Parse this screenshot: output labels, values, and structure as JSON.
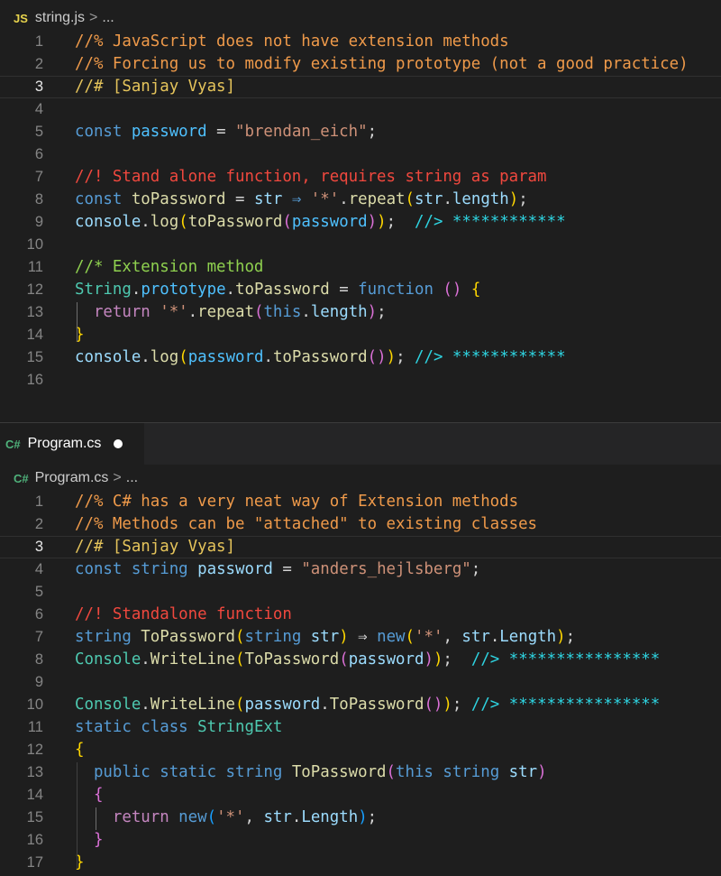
{
  "editor_top": {
    "breadcrumb": {
      "icon": "JS",
      "file": "string.js",
      "sep": ">",
      "more": "..."
    },
    "lines": [
      {
        "n": "1",
        "tokens": [
          [
            "//% JavaScript does not have extension methods",
            "#ef9a4a"
          ]
        ]
      },
      {
        "n": "2",
        "tokens": [
          [
            "//% Forcing us to modify existing prototype (not a good practice)",
            "#ef9a4a"
          ]
        ]
      },
      {
        "n": "3",
        "current": true,
        "tokens": [
          [
            "//# [Sanjay Vyas]",
            "#e5c45b"
          ]
        ]
      },
      {
        "n": "4",
        "tokens": []
      },
      {
        "n": "5",
        "tokens": [
          [
            "const ",
            "#569cd6"
          ],
          [
            "password",
            "#4fc1ff"
          ],
          [
            " = ",
            "#d4d4d4"
          ],
          [
            "\"brendan_eich\"",
            "#ce9178"
          ],
          [
            ";",
            "#d4d4d4"
          ]
        ]
      },
      {
        "n": "6",
        "tokens": []
      },
      {
        "n": "7",
        "tokens": [
          [
            "//! Stand alone function, requires string as param",
            "#f0483e"
          ]
        ]
      },
      {
        "n": "8",
        "tokens": [
          [
            "const ",
            "#569cd6"
          ],
          [
            "toPassword",
            "#dcdcaa"
          ],
          [
            " = ",
            "#d4d4d4"
          ],
          [
            "str",
            "#9cdcfe"
          ],
          [
            " ⇒ ",
            "#569cd6"
          ],
          [
            "'*'",
            "#ce9178"
          ],
          [
            ".",
            "#d4d4d4"
          ],
          [
            "repeat",
            "#dcdcaa"
          ],
          [
            "(",
            "#ffd700"
          ],
          [
            "str",
            "#9cdcfe"
          ],
          [
            ".",
            "#d4d4d4"
          ],
          [
            "length",
            "#9cdcfe"
          ],
          [
            ")",
            "#ffd700"
          ],
          [
            ";",
            "#d4d4d4"
          ]
        ]
      },
      {
        "n": "9",
        "tokens": [
          [
            "console",
            "#9cdcfe"
          ],
          [
            ".",
            "#d4d4d4"
          ],
          [
            "log",
            "#dcdcaa"
          ],
          [
            "(",
            "#ffd700"
          ],
          [
            "toPassword",
            "#dcdcaa"
          ],
          [
            "(",
            "#da70d6"
          ],
          [
            "password",
            "#4fc1ff"
          ],
          [
            ")",
            "#da70d6"
          ],
          [
            ")",
            "#ffd700"
          ],
          [
            ";  ",
            "#d4d4d4"
          ],
          [
            "//> ************",
            "#2ed3e0"
          ]
        ]
      },
      {
        "n": "10",
        "tokens": []
      },
      {
        "n": "11",
        "tokens": [
          [
            "//* Extension method",
            "#8fd14f"
          ]
        ]
      },
      {
        "n": "12",
        "tokens": [
          [
            "String",
            "#4ec9b0"
          ],
          [
            ".",
            "#d4d4d4"
          ],
          [
            "prototype",
            "#4fc1ff"
          ],
          [
            ".",
            "#d4d4d4"
          ],
          [
            "toPassword",
            "#dcdcaa"
          ],
          [
            " = ",
            "#d4d4d4"
          ],
          [
            "function",
            "#569cd6"
          ],
          [
            " ",
            "#d4d4d4"
          ],
          [
            "()",
            "#da70d6"
          ],
          [
            " ",
            "#d4d4d4"
          ],
          [
            "{",
            "#ffd700"
          ]
        ]
      },
      {
        "n": "13",
        "tokens": [
          [
            "  return ",
            "#c586c0"
          ],
          [
            "'*'",
            "#ce9178"
          ],
          [
            ".",
            "#d4d4d4"
          ],
          [
            "repeat",
            "#dcdcaa"
          ],
          [
            "(",
            "#da70d6"
          ],
          [
            "this",
            "#569cd6"
          ],
          [
            ".",
            "#d4d4d4"
          ],
          [
            "length",
            "#9cdcfe"
          ],
          [
            ")",
            "#da70d6"
          ],
          [
            ";",
            "#d4d4d4"
          ]
        ]
      },
      {
        "n": "14",
        "tokens": [
          [
            "}",
            "#ffd700"
          ]
        ]
      },
      {
        "n": "15",
        "tokens": [
          [
            "console",
            "#9cdcfe"
          ],
          [
            ".",
            "#d4d4d4"
          ],
          [
            "log",
            "#dcdcaa"
          ],
          [
            "(",
            "#ffd700"
          ],
          [
            "password",
            "#4fc1ff"
          ],
          [
            ".",
            "#d4d4d4"
          ],
          [
            "toPassword",
            "#dcdcaa"
          ],
          [
            "()",
            "#da70d6"
          ],
          [
            ")",
            "#ffd700"
          ],
          [
            "; ",
            "#d4d4d4"
          ],
          [
            "//> ************",
            "#2ed3e0"
          ]
        ]
      },
      {
        "n": "16",
        "tokens": []
      }
    ]
  },
  "tab": {
    "icon": "C#",
    "label": "Program.cs"
  },
  "editor_bottom": {
    "breadcrumb": {
      "icon": "C#",
      "file": "Program.cs",
      "sep": ">",
      "more": "..."
    },
    "lines": [
      {
        "n": "1",
        "tokens": [
          [
            "//% C# has a very neat way of Extension methods",
            "#ef9a4a"
          ]
        ]
      },
      {
        "n": "2",
        "tokens": [
          [
            "//% Methods can be \"attached\" to existing classes",
            "#ef9a4a"
          ]
        ]
      },
      {
        "n": "3",
        "current": true,
        "tokens": [
          [
            "//# [Sanjay Vyas]",
            "#e5c45b"
          ]
        ]
      },
      {
        "n": "4",
        "tokens": [
          [
            "const ",
            "#569cd6"
          ],
          [
            "string ",
            "#569cd6"
          ],
          [
            "password",
            "#9cdcfe"
          ],
          [
            " = ",
            "#d4d4d4"
          ],
          [
            "\"anders_hejlsberg\"",
            "#ce9178"
          ],
          [
            ";",
            "#d4d4d4"
          ]
        ]
      },
      {
        "n": "5",
        "tokens": []
      },
      {
        "n": "6",
        "tokens": [
          [
            "//! Standalone function",
            "#f0483e"
          ]
        ]
      },
      {
        "n": "7",
        "tokens": [
          [
            "string ",
            "#569cd6"
          ],
          [
            "ToPassword",
            "#dcdcaa"
          ],
          [
            "(",
            "#ffd700"
          ],
          [
            "string ",
            "#569cd6"
          ],
          [
            "str",
            "#9cdcfe"
          ],
          [
            ")",
            "#ffd700"
          ],
          [
            " ⇒ ",
            "#d4d4d4"
          ],
          [
            "new",
            "#569cd6"
          ],
          [
            "(",
            "#ffd700"
          ],
          [
            "'*'",
            "#ce9178"
          ],
          [
            ", ",
            "#d4d4d4"
          ],
          [
            "str",
            "#9cdcfe"
          ],
          [
            ".",
            "#d4d4d4"
          ],
          [
            "Length",
            "#9cdcfe"
          ],
          [
            ")",
            "#ffd700"
          ],
          [
            ";",
            "#d4d4d4"
          ]
        ]
      },
      {
        "n": "8",
        "tokens": [
          [
            "Console",
            "#4ec9b0"
          ],
          [
            ".",
            "#d4d4d4"
          ],
          [
            "WriteLine",
            "#dcdcaa"
          ],
          [
            "(",
            "#ffd700"
          ],
          [
            "ToPassword",
            "#dcdcaa"
          ],
          [
            "(",
            "#da70d6"
          ],
          [
            "password",
            "#9cdcfe"
          ],
          [
            ")",
            "#da70d6"
          ],
          [
            ")",
            "#ffd700"
          ],
          [
            ";  ",
            "#d4d4d4"
          ],
          [
            "//> ****************",
            "#2ed3e0"
          ]
        ]
      },
      {
        "n": "9",
        "tokens": []
      },
      {
        "n": "10",
        "tokens": [
          [
            "Console",
            "#4ec9b0"
          ],
          [
            ".",
            "#d4d4d4"
          ],
          [
            "WriteLine",
            "#dcdcaa"
          ],
          [
            "(",
            "#ffd700"
          ],
          [
            "password",
            "#9cdcfe"
          ],
          [
            ".",
            "#d4d4d4"
          ],
          [
            "ToPassword",
            "#dcdcaa"
          ],
          [
            "()",
            "#da70d6"
          ],
          [
            ")",
            "#ffd700"
          ],
          [
            "; ",
            "#d4d4d4"
          ],
          [
            "//> ****************",
            "#2ed3e0"
          ]
        ]
      },
      {
        "n": "11",
        "tokens": [
          [
            "static ",
            "#569cd6"
          ],
          [
            "class ",
            "#569cd6"
          ],
          [
            "StringExt",
            "#4ec9b0"
          ]
        ]
      },
      {
        "n": "12",
        "tokens": [
          [
            "{",
            "#ffd700"
          ]
        ]
      },
      {
        "n": "13",
        "tokens": [
          [
            "  public ",
            "#569cd6"
          ],
          [
            "static ",
            "#569cd6"
          ],
          [
            "string ",
            "#569cd6"
          ],
          [
            "ToPassword",
            "#dcdcaa"
          ],
          [
            "(",
            "#da70d6"
          ],
          [
            "this ",
            "#569cd6"
          ],
          [
            "string ",
            "#569cd6"
          ],
          [
            "str",
            "#9cdcfe"
          ],
          [
            ")",
            "#da70d6"
          ]
        ]
      },
      {
        "n": "14",
        "tokens": [
          [
            "  {",
            "#da70d6"
          ]
        ]
      },
      {
        "n": "15",
        "tokens": [
          [
            "    return ",
            "#c586c0"
          ],
          [
            "new",
            "#569cd6"
          ],
          [
            "(",
            "#179fff"
          ],
          [
            "'*'",
            "#ce9178"
          ],
          [
            ", ",
            "#d4d4d4"
          ],
          [
            "str",
            "#9cdcfe"
          ],
          [
            ".",
            "#d4d4d4"
          ],
          [
            "Length",
            "#9cdcfe"
          ],
          [
            ")",
            "#179fff"
          ],
          [
            ";",
            "#d4d4d4"
          ]
        ]
      },
      {
        "n": "16",
        "tokens": [
          [
            "  }",
            "#da70d6"
          ]
        ]
      },
      {
        "n": "17",
        "tokens": [
          [
            "}",
            "#ffd700"
          ]
        ]
      }
    ]
  }
}
